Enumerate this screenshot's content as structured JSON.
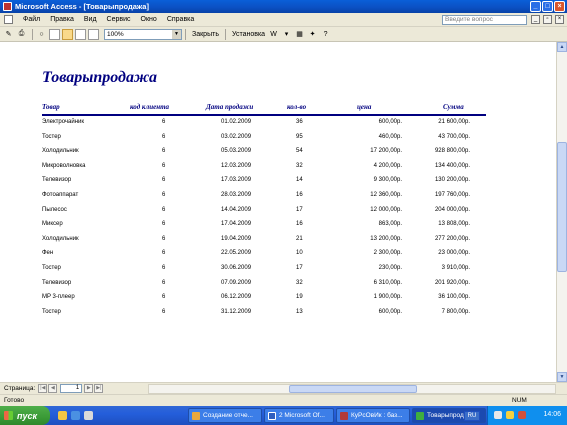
{
  "window": {
    "title": "Microsoft Access - [Товарыпродажа]"
  },
  "menu": {
    "items": [
      "Файл",
      "Правка",
      "Вид",
      "Сервис",
      "Окно",
      "Справка"
    ],
    "help_placeholder": "Введите вопрос"
  },
  "toolbar": {
    "zoom": "100%",
    "close_label": "Закрыть",
    "setup_label": "Установка"
  },
  "report": {
    "title": "Товарыпродажа",
    "columns": {
      "product": "Товар",
      "client_code": "код клиента",
      "sale_date": "Дата продажи",
      "qty": "кол-во",
      "price": "цена",
      "total": "Сумма"
    },
    "rows": [
      {
        "product": "Электрочайник",
        "client": "6",
        "date": "01.02.2009",
        "qty": "36",
        "price": "600,00р.",
        "total": "21 600,00р."
      },
      {
        "product": "Тостер",
        "client": "6",
        "date": "03.02.2009",
        "qty": "95",
        "price": "460,00р.",
        "total": "43 700,00р."
      },
      {
        "product": "Холодильник",
        "client": "6",
        "date": "05.03.2009",
        "qty": "54",
        "price": "17 200,00р.",
        "total": "928 800,00р."
      },
      {
        "product": "Микроволновка",
        "client": "6",
        "date": "12.03.2009",
        "qty": "32",
        "price": "4 200,00р.",
        "total": "134 400,00р."
      },
      {
        "product": "Телевизор",
        "client": "6",
        "date": "17.03.2009",
        "qty": "14",
        "price": "9 300,00р.",
        "total": "130 200,00р."
      },
      {
        "product": "Фотоаппарат",
        "client": "6",
        "date": "28.03.2009",
        "qty": "16",
        "price": "12 360,00р.",
        "total": "197 760,00р."
      },
      {
        "product": "Пылесос",
        "client": "6",
        "date": "14.04.2009",
        "qty": "17",
        "price": "12 000,00р.",
        "total": "204 000,00р."
      },
      {
        "product": "Миксер",
        "client": "6",
        "date": "17.04.2009",
        "qty": "16",
        "price": "863,00р.",
        "total": "13 808,00р."
      },
      {
        "product": "Холодильник",
        "client": "6",
        "date": "19.04.2009",
        "qty": "21",
        "price": "13 200,00р.",
        "total": "277 200,00р."
      },
      {
        "product": "Фен",
        "client": "6",
        "date": "22.05.2009",
        "qty": "10",
        "price": "2 300,00р.",
        "total": "23 000,00р."
      },
      {
        "product": "Тостер",
        "client": "6",
        "date": "30.06.2009",
        "qty": "17",
        "price": "230,00р.",
        "total": "3 910,00р."
      },
      {
        "product": "Телевизор",
        "client": "6",
        "date": "07.09.2009",
        "qty": "32",
        "price": "6 310,00р.",
        "total": "201 920,00р."
      },
      {
        "product": "MP 3-плеер",
        "client": "6",
        "date": "06.12.2009",
        "qty": "19",
        "price": "1 900,00р.",
        "total": "36 100,00р."
      },
      {
        "product": "Тостер",
        "client": "6",
        "date": "31.12.2009",
        "qty": "13",
        "price": "600,00р.",
        "total": "7 800,00р."
      }
    ]
  },
  "navigation": {
    "page_label": "Страница:",
    "page_value": "1"
  },
  "status": {
    "ready": "Готово",
    "num": "NUM"
  },
  "taskbar": {
    "start": "пуск",
    "tasks": [
      "Создание отче...",
      "2 Microsoft Of...",
      "КуРсОвИк : баз...",
      "Товарыпродажа"
    ],
    "lang": "RU",
    "clock": "14:06"
  }
}
